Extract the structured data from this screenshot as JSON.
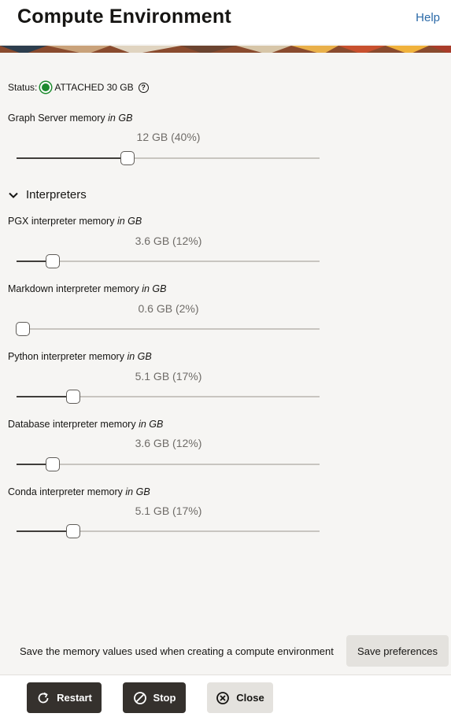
{
  "header": {
    "title": "Compute Environment",
    "help_label": "Help"
  },
  "status": {
    "label": "Status:",
    "value": "ATTACHED 30 GB",
    "color": "#1d8a2e",
    "help_icon": "question-circle-icon"
  },
  "graph_server": {
    "label": "Graph Server memory",
    "unit": "in GB",
    "value_text": "12 GB (40%)",
    "fraction": 0.365
  },
  "interpreters": {
    "section_label": "Interpreters",
    "expanded": true,
    "items": [
      {
        "label": "PGX interpreter memory",
        "unit": "in GB",
        "value_text": "3.6 GB (12%)",
        "fraction": 0.12
      },
      {
        "label": "Markdown interpreter memory",
        "unit": "in GB",
        "value_text": "0.6 GB (2%)",
        "fraction": 0.02
      },
      {
        "label": "Python interpreter memory",
        "unit": "in GB",
        "value_text": "5.1 GB (17%)",
        "fraction": 0.187
      },
      {
        "label": "Database interpreter memory",
        "unit": "in GB",
        "value_text": "3.6 GB (12%)",
        "fraction": 0.12
      },
      {
        "label": "Conda interpreter memory",
        "unit": "in GB",
        "value_text": "5.1 GB (17%)",
        "fraction": 0.187
      }
    ]
  },
  "save": {
    "description": "Save the memory values used when creating a compute environment",
    "button_label": "Save preferences"
  },
  "footer": {
    "restart_label": "Restart",
    "stop_label": "Stop",
    "close_label": "Close"
  },
  "colors": {
    "accent_link": "#2b6aa8",
    "dark_button": "#35312d",
    "status_green": "#1d8a2e"
  }
}
